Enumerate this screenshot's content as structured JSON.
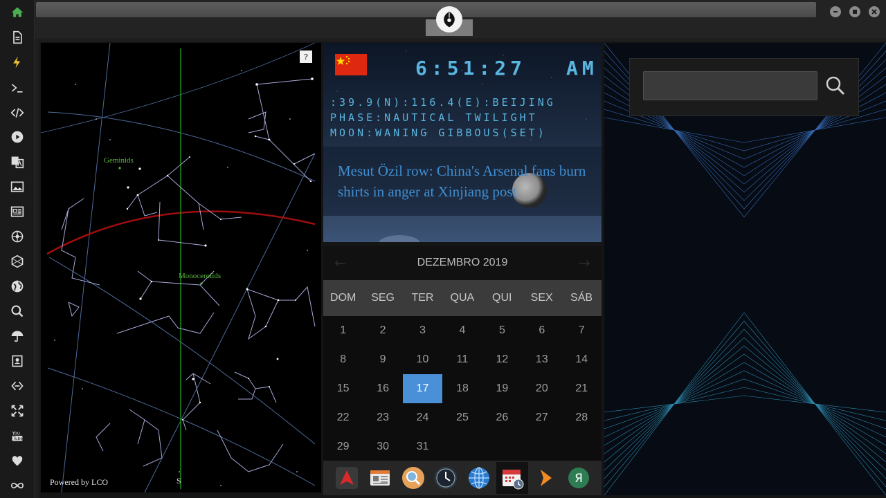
{
  "sidebar": {
    "items": [
      {
        "icon": "home-icon",
        "color": "#4caf50"
      },
      {
        "icon": "document-icon"
      },
      {
        "icon": "lightning-icon"
      },
      {
        "icon": "terminal-icon"
      },
      {
        "icon": "code-icon"
      },
      {
        "icon": "play-icon"
      },
      {
        "icon": "translate-icon"
      },
      {
        "icon": "image-icon"
      },
      {
        "icon": "newspaper-icon"
      },
      {
        "icon": "rebel-icon"
      },
      {
        "icon": "hexagon-icon"
      },
      {
        "icon": "globe-icon"
      },
      {
        "icon": "search-icon"
      },
      {
        "icon": "umbrella-icon"
      },
      {
        "icon": "contact-icon"
      },
      {
        "icon": "link-icon"
      },
      {
        "icon": "expand-icon"
      },
      {
        "icon": "youtube-icon"
      },
      {
        "icon": "heart-icon"
      },
      {
        "icon": "infinity-icon"
      }
    ]
  },
  "skymap": {
    "help": "?",
    "powered_by": "Powered by LCO",
    "direction": "S",
    "labels": {
      "geminids": "Geminids",
      "monocerotids": "Monocerotids"
    }
  },
  "clock": {
    "flag": "China",
    "time": "6:51:27",
    "ampm": "AM",
    "location": ":39.9(N):116.4(E):BEIJING",
    "phase": "PHASE:NAUTICAL TWILIGHT",
    "moon": "MOON:WANING GIBBOUS(SET)",
    "headline": "Mesut Özil row: China's Arsenal fans burn shirts in anger at Xinjiang post",
    "accent": "#5ab6e0"
  },
  "calendar": {
    "title": "DEZEMBRO 2019",
    "prev": "←",
    "next": "→",
    "weekdays": [
      "DOM",
      "SEG",
      "TER",
      "QUA",
      "QUI",
      "SEX",
      "SÁB"
    ],
    "days": [
      "1",
      "2",
      "3",
      "4",
      "5",
      "6",
      "7",
      "8",
      "9",
      "10",
      "11",
      "12",
      "13",
      "14",
      "15",
      "16",
      "17",
      "18",
      "19",
      "20",
      "21",
      "22",
      "23",
      "24",
      "25",
      "26",
      "27",
      "28",
      "29",
      "30",
      "31"
    ],
    "selected": "17",
    "selected_color": "#4a90d9"
  },
  "dock": {
    "items": [
      "arch-app-icon",
      "news-app-icon",
      "search-app-icon",
      "clock-app-icon",
      "browser-globe-icon",
      "calendar-app-icon",
      "play-arrow-icon",
      "yandex-icon"
    ]
  },
  "search": {
    "placeholder": "",
    "value": ""
  }
}
